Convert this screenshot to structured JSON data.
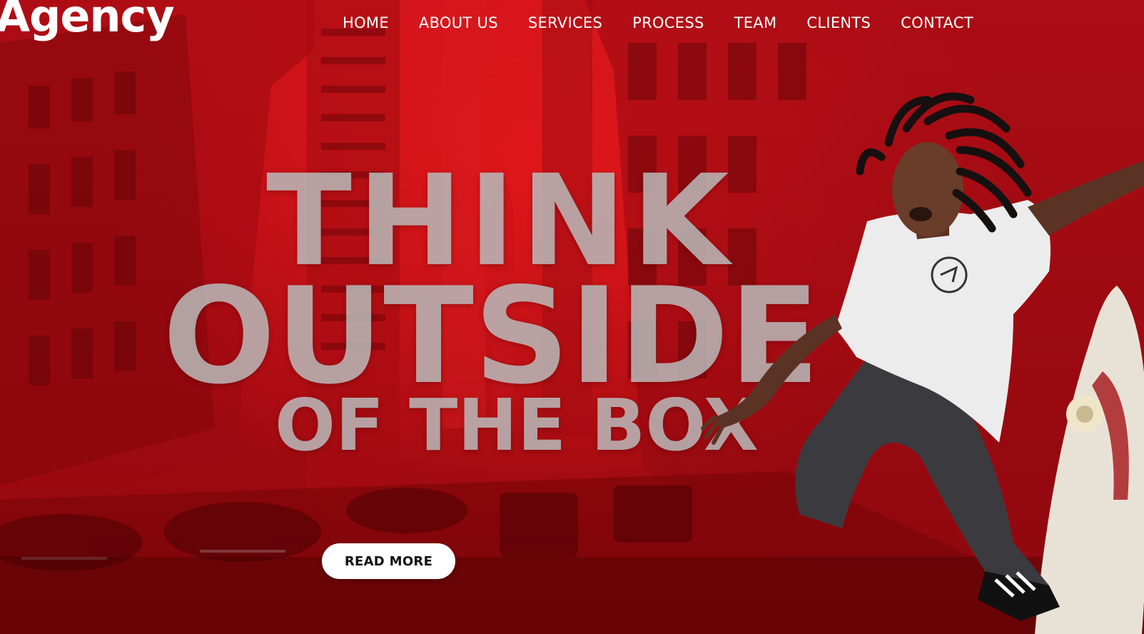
{
  "brand": {
    "logo_text": "Agency"
  },
  "nav": {
    "items": [
      {
        "label": "HOME"
      },
      {
        "label": "ABOUT US"
      },
      {
        "label": "SERVICES"
      },
      {
        "label": "PROCESS"
      },
      {
        "label": "TEAM"
      },
      {
        "label": "CLIENTS"
      },
      {
        "label": "CONTACT"
      }
    ]
  },
  "hero": {
    "headline_line1": "THINK",
    "headline_line2": "OUTSIDE",
    "headline_line3": "OF THE BOX",
    "cta_label": "READ MORE"
  },
  "colors": {
    "background_red": "#c8121a",
    "headline_gray": "#b9b9b9",
    "nav_text": "#ffffff",
    "button_bg": "#ffffff",
    "button_text": "#111111"
  },
  "icons": {
    "background": "city-street-photo",
    "figure": "skateboarder-photo"
  }
}
